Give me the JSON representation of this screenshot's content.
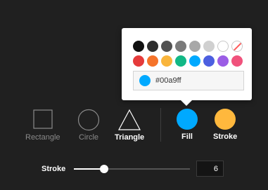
{
  "color_picker": {
    "swatches_row1": [
      "#111111",
      "#2e2e2e",
      "#525252",
      "#7a7a7a",
      "#a8a8a8",
      "#d0d0d0",
      "#ffffff",
      "none"
    ],
    "swatches_row2": [
      "#e53b3b",
      "#f5732a",
      "#f9b53c",
      "#12b886",
      "#00a9ff",
      "#4c5fe0",
      "#9b5de5",
      "#f0527c"
    ],
    "hex_value": "#00a9ff"
  },
  "shapes": {
    "rectangle_label": "Rectangle",
    "circle_label": "Circle",
    "triangle_label": "Triangle",
    "selected": "triangle"
  },
  "colors": {
    "fill_label": "Fill",
    "fill_color": "#00a9ff",
    "stroke_label": "Stroke",
    "stroke_color": "#ffb83d"
  },
  "stroke": {
    "label": "Stroke",
    "value": "6",
    "min": 0,
    "max": 100
  }
}
